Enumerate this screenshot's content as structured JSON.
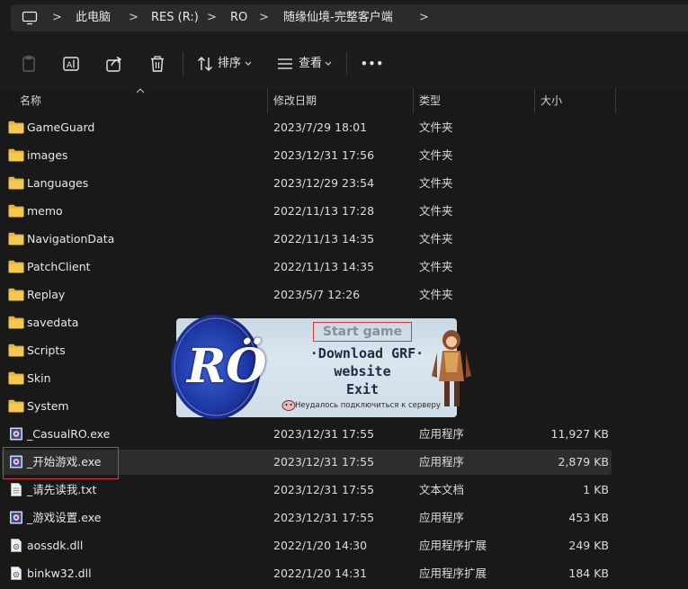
{
  "breadcrumb": {
    "items": [
      "此电脑",
      "RES (R:)",
      "RO",
      "随缘仙境-完整客户端"
    ]
  },
  "toolbar": {
    "sort_label": "排序",
    "view_label": "查看",
    "more_label": "•••"
  },
  "columns": {
    "name": "名称",
    "date": "修改日期",
    "type": "类型",
    "size": "大小"
  },
  "files": [
    {
      "name": "GameGuard",
      "date": "2023/7/29 18:01",
      "type": "文件夹",
      "size": "",
      "icon": "folder-icon"
    },
    {
      "name": "images",
      "date": "2023/12/31 17:56",
      "type": "文件夹",
      "size": "",
      "icon": "folder-icon"
    },
    {
      "name": "Languages",
      "date": "2023/12/29 23:54",
      "type": "文件夹",
      "size": "",
      "icon": "folder-icon"
    },
    {
      "name": "memo",
      "date": "2022/11/13 17:28",
      "type": "文件夹",
      "size": "",
      "icon": "folder-icon"
    },
    {
      "name": "NavigationData",
      "date": "2022/11/13 14:35",
      "type": "文件夹",
      "size": "",
      "icon": "folder-icon"
    },
    {
      "name": "PatchClient",
      "date": "2022/11/13 14:35",
      "type": "文件夹",
      "size": "",
      "icon": "folder-icon"
    },
    {
      "name": "Replay",
      "date": "2023/5/7 12:26",
      "type": "文件夹",
      "size": "",
      "icon": "folder-icon"
    },
    {
      "name": "savedata",
      "date": "",
      "type": "",
      "size": "",
      "icon": "folder-icon"
    },
    {
      "name": "Scripts",
      "date": "",
      "type": "",
      "size": "",
      "icon": "folder-icon"
    },
    {
      "name": "Skin",
      "date": "",
      "type": "",
      "size": "",
      "icon": "folder-icon"
    },
    {
      "name": "System",
      "date": "",
      "type": "",
      "size": "",
      "icon": "folder-icon"
    },
    {
      "name": "_CasualRO.exe",
      "date": "2023/12/31 17:55",
      "type": "应用程序",
      "size": "11,927 KB",
      "icon": "exe-icon"
    },
    {
      "name": "_开始游戏.exe",
      "date": "2023/12/31 17:55",
      "type": "应用程序",
      "size": "2,879 KB",
      "icon": "exe-icon"
    },
    {
      "name": "_请先读我.txt",
      "date": "2023/12/31 17:55",
      "type": "文本文档",
      "size": "1 KB",
      "icon": "txt-icon"
    },
    {
      "name": "_游戏设置.exe",
      "date": "2023/12/31 17:55",
      "type": "应用程序",
      "size": "453 KB",
      "icon": "exe-icon"
    },
    {
      "name": "aossdk.dll",
      "date": "2022/1/20 14:30",
      "type": "应用程序扩展",
      "size": "249 KB",
      "icon": "dll-icon"
    },
    {
      "name": "binkw32.dll",
      "date": "2022/1/20 14:31",
      "type": "应用程序扩展",
      "size": "184 KB",
      "icon": "dll-icon"
    }
  ],
  "splash": {
    "logo_text": "RÖ",
    "start": "Start game",
    "download": "·Download GRF·",
    "website": "website",
    "exit": "Exit",
    "status": "Неудалось подключиться к серверу"
  },
  "colors": {
    "folder": "#f0c14b",
    "highlight": "#d83a3a",
    "background": "#191919"
  }
}
